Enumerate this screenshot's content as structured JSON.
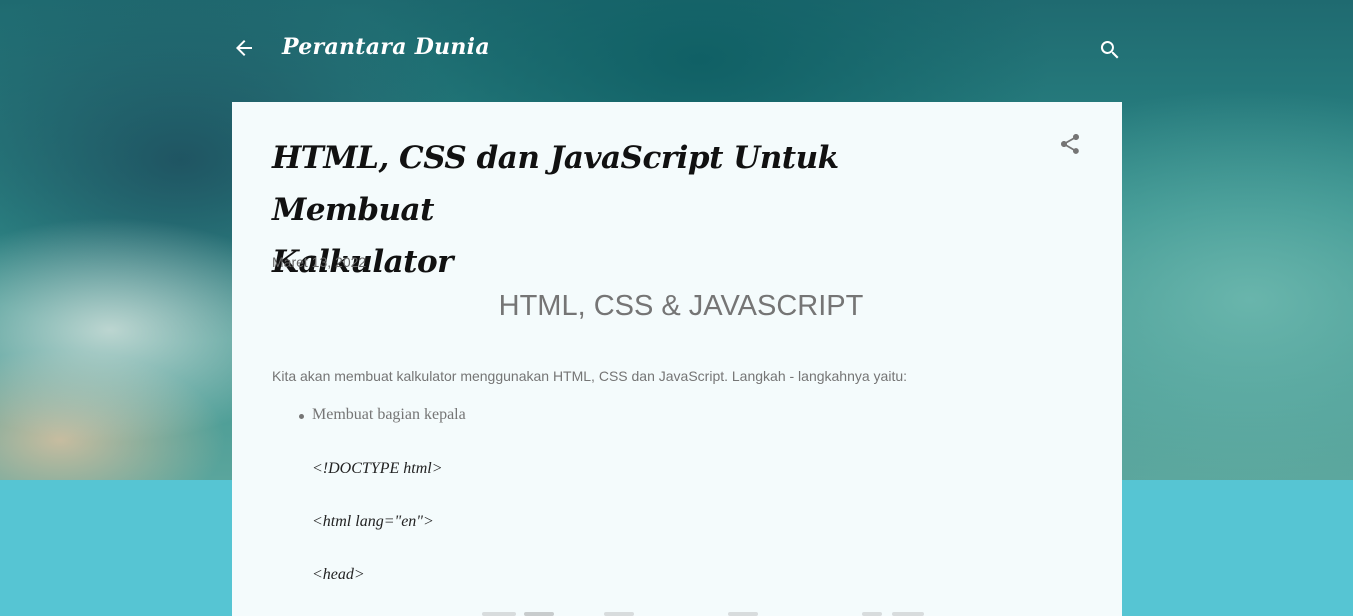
{
  "header": {
    "blog_title": "Perantara Dunia",
    "back_icon": "arrow-back-icon",
    "search_icon": "search-icon"
  },
  "post": {
    "title_line1": "HTML, CSS dan JavaScript Untuk Membuat",
    "title_line2": "Kalkulator",
    "date": "Maret 13, 2022",
    "share_icon": "share-icon",
    "section_heading": "HTML, CSS & JAVASCRIPT",
    "intro": "Kita akan membuat kalkulator menggunakan HTML, CSS dan JavaScript. Langkah - langkahnya yaitu:",
    "list": [
      "Membuat bagian kepala"
    ],
    "code_lines": [
      "<!DOCTYPE html>",
      "<html lang=\"en\">",
      "<head>"
    ]
  },
  "colors": {
    "page_bg": "#56c5d3",
    "card_bg": "#f4fbfc",
    "header_text": "#ffffff",
    "muted_text": "#757575"
  }
}
